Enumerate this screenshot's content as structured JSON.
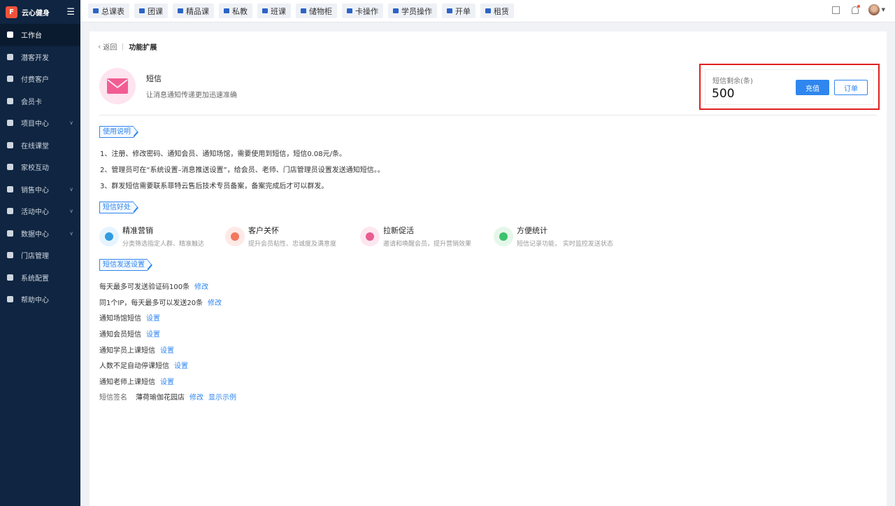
{
  "app": {
    "logo_char": "F",
    "name": "云心健身",
    "menu_icon": "hamburger-icon"
  },
  "sidebar": {
    "items": [
      {
        "label": "工作台",
        "active": true,
        "has_arrow": false
      },
      {
        "label": "潜客开发",
        "active": false,
        "has_arrow": false
      },
      {
        "label": "付费客户",
        "active": false,
        "has_arrow": false
      },
      {
        "label": "会员卡",
        "active": false,
        "has_arrow": false
      },
      {
        "label": "项目中心",
        "active": false,
        "has_arrow": true
      },
      {
        "label": "在线课堂",
        "active": false,
        "has_arrow": false
      },
      {
        "label": "家校互动",
        "active": false,
        "has_arrow": false
      },
      {
        "label": "销售中心",
        "active": false,
        "has_arrow": true
      },
      {
        "label": "活动中心",
        "active": false,
        "has_arrow": true
      },
      {
        "label": "数据中心",
        "active": false,
        "has_arrow": true
      },
      {
        "label": "门店管理",
        "active": false,
        "has_arrow": false
      },
      {
        "label": "系统配置",
        "active": false,
        "has_arrow": false
      },
      {
        "label": "帮助中心",
        "active": false,
        "has_arrow": false
      }
    ]
  },
  "topbar": {
    "tabs": [
      "总课表",
      "团课",
      "精品课",
      "私教",
      "班课",
      "储物柜",
      "卡操作",
      "学员操作",
      "开单",
      "租赁"
    ]
  },
  "breadcrumb": {
    "back": "返回",
    "title": "功能扩展"
  },
  "sms": {
    "title": "短信",
    "desc": "让消息通知传递更加迅速准确"
  },
  "balance": {
    "label": "短信剩余(条)",
    "value": "500",
    "recharge": "充值",
    "order": "订单"
  },
  "sections": {
    "usage": "使用说明",
    "benefits": "短信好处",
    "settings": "短信发送设置"
  },
  "instructions": [
    "1、注册、修改密码、通知会员、通知场馆，需要使用到短信，短信0.08元/条。",
    "2、管理员可在“系统设置–消息推送设置”，给会员、老师、门店管理员设置发送通知短信。。",
    "3、群发短信需要联系菲特云售后技术专员备案，备案完成后才可以群发。"
  ],
  "benefits": [
    {
      "title": "精准营销",
      "desc": "分类筛选指定人群、精准触达",
      "bg": "#e6f4ff",
      "color": "#2f9be0",
      "icon": "target-icon"
    },
    {
      "title": "客户关怀",
      "desc": "提升会员粘性、忠诚度及满意度",
      "bg": "#fde9e6",
      "color": "#f2785f",
      "icon": "user-care-icon"
    },
    {
      "title": "拉新促活",
      "desc": "邀请和唤醒会员，提升营销效果",
      "bg": "#fde6ef",
      "color": "#ea5b8f",
      "icon": "user-add-icon"
    },
    {
      "title": "方便统计",
      "desc": "短信记录功能， 实时监控发送状态",
      "bg": "#e5f7ea",
      "color": "#3cc26b",
      "icon": "pie-chart-icon"
    }
  ],
  "settings": [
    {
      "label": "每天最多可发送验证码100条",
      "action": "修改"
    },
    {
      "label": "同1个IP，每天最多可以发送20条",
      "action": "修改"
    },
    {
      "label": "通知场馆短信",
      "action": "设置"
    },
    {
      "label": "通知会员短信",
      "action": "设置"
    },
    {
      "label": "通知学员上课短信",
      "action": "设置"
    },
    {
      "label": "人数不足自动停课短信",
      "action": "设置"
    },
    {
      "label": "通知老师上课短信",
      "action": "设置"
    }
  ],
  "signature": {
    "label": "短信签名",
    "value": "薄荷瑜伽花园店",
    "edit": "修改",
    "example": "显示示例"
  }
}
